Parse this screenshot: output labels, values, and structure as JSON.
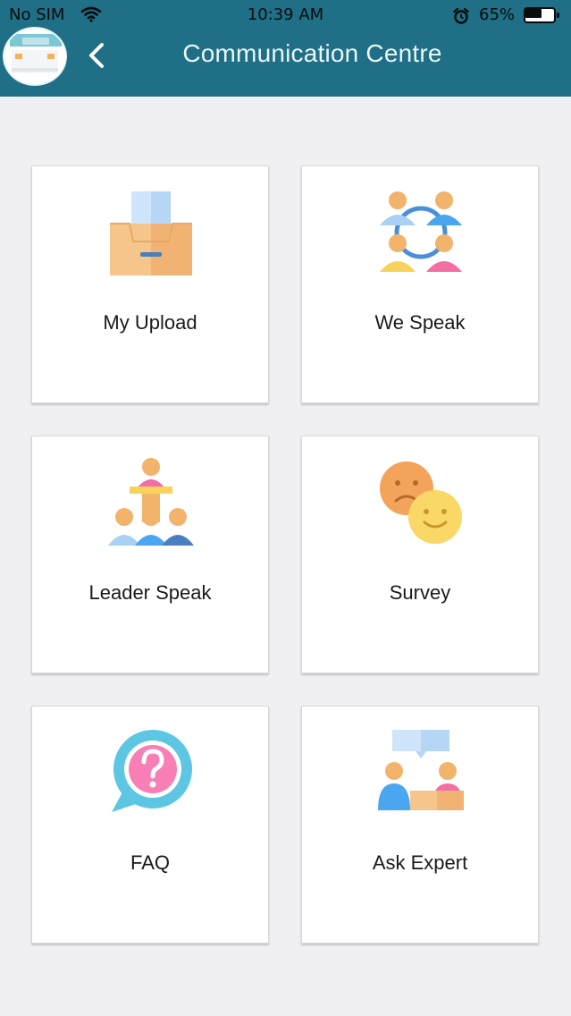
{
  "status_bar": {
    "carrier": "No SIM",
    "time": "10:39 AM",
    "battery_text": "65%",
    "battery_level": 0.65
  },
  "header": {
    "title": "Communication Centre",
    "back_icon": "chevron-left-icon",
    "background_color": "#1f6f86"
  },
  "tiles": [
    {
      "label": "My Upload",
      "icon": "upload-tray-icon"
    },
    {
      "label": "We Speak",
      "icon": "group-network-icon"
    },
    {
      "label": "Leader Speak",
      "icon": "leader-podium-icon"
    },
    {
      "label": "Survey",
      "icon": "smiley-faces-icon"
    },
    {
      "label": "FAQ",
      "icon": "question-bubble-icon"
    },
    {
      "label": "Ask Expert",
      "icon": "expert-consultation-icon"
    }
  ]
}
